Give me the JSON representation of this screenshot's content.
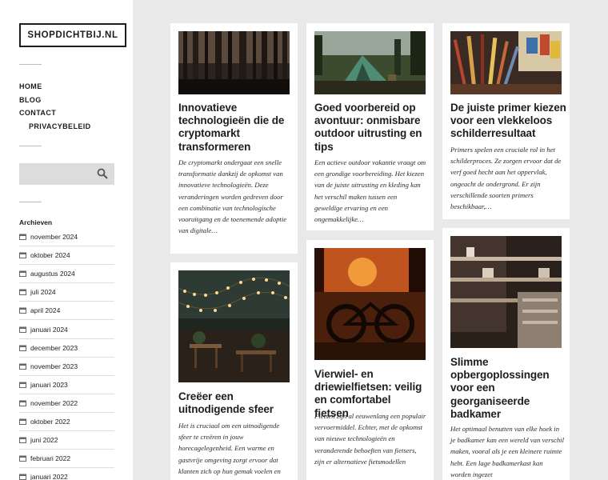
{
  "site": {
    "logo": "SHOPDICHTBIJ.NL"
  },
  "nav": {
    "items": [
      {
        "label": "HOME"
      },
      {
        "label": "BLOG"
      },
      {
        "label": "CONTACT"
      },
      {
        "label": "PRIVACYBELEID"
      }
    ]
  },
  "search": {
    "placeholder": ""
  },
  "archives": {
    "title": "Archieven",
    "items": [
      "november 2024",
      "oktober 2024",
      "augustus 2024",
      "juli 2024",
      "april 2024",
      "januari 2024",
      "december 2023",
      "november 2023",
      "januari 2023",
      "november 2022",
      "oktober 2022",
      "juni 2022",
      "februari 2022",
      "januari 2022"
    ]
  },
  "posts": [
    {
      "title": "Innovatieve technologieën die de cryptomarkt transformeren",
      "excerpt": "De cryptomarkt ondergaat een snelle transformatie dankzij de opkomst van innovatieve technologieën. Deze veranderingen worden gedreven door een combinatie van technologische vooruitgang en de toenemende adoptie van digitale…",
      "image_icon": "forest-photo"
    },
    {
      "title": "Goed voorbereid op avontuur: onmisbare outdoor uitrusting en tips",
      "excerpt": "Een actieve outdoor vakantie vraagt om een grondige voorbereiding. Het kiezen van de juiste uitrusting en kleding kan het verschil maken tussen een geweldige ervaring en een ongemakkelijke…",
      "image_icon": "tent-photo"
    },
    {
      "title": "De juiste primer kiezen voor een vlekkeloos schilderresultaat",
      "excerpt": "Primers spelen een cruciale rol in het schilderproces. Ze zorgen ervoor dat de verf goed hecht aan het oppervlak, ongeacht de ondergrond. Er zijn verschillende soorten primers beschikbaar,…",
      "image_icon": "paintbrush-photo"
    },
    {
      "title": "Creëer een uitnodigende sfeer",
      "excerpt": "Het is cruciaal om een uitnodigende sfeer te creëren in jouw horecagelegenheid. Een warme en gastvrije omgeving zorgt ervoor dat klanten zich op hun gemak voelen en",
      "image_icon": "terrace-lights-photo"
    },
    {
      "title": "Vierwiel- en driewielfietsen: veilig en comfortabel fietsen",
      "excerpt": "Fietsen zijn al eeuwenlang een populair vervoermiddel. Echter, met de opkomst van nieuwe technologieën en veranderende behoeften van fietsers, zijn er alternatieve fietsmodellen",
      "image_icon": "bike-sunset-photo"
    },
    {
      "title": "Slimme opbergoplossingen voor een georganiseerde badkamer",
      "excerpt": "Het optimaal benutten van elke hoek in je badkamer kan een wereld van verschil maken, vooral als je een kleinere ruimte hebt. Een lage badkamerkast kan worden ingezet",
      "image_icon": "shelves-photo"
    }
  ]
}
